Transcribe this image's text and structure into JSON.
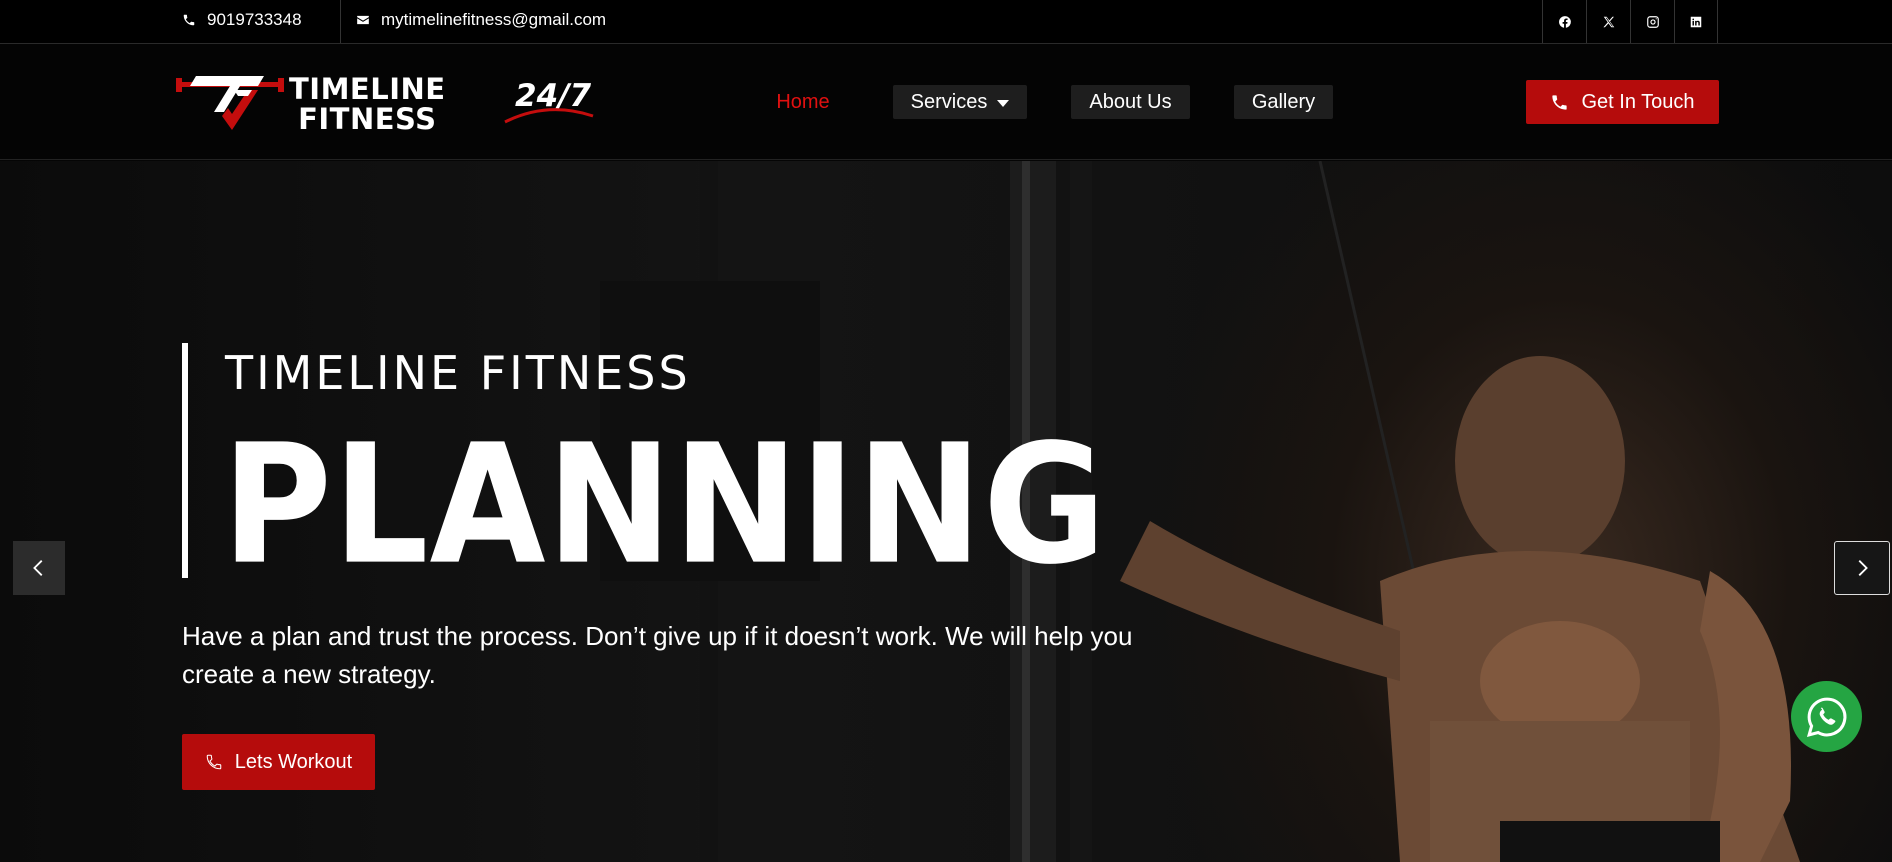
{
  "topbar": {
    "phone": "9019733348",
    "email": "mytimelinefitness@gmail.com",
    "socials": [
      "facebook-icon",
      "x-icon",
      "instagram-icon",
      "linkedin-icon"
    ]
  },
  "header": {
    "logo_line1": "TIMELINE",
    "logo_line2": "FITNESS",
    "badge": "24/7",
    "nav": {
      "home": "Home",
      "services": "Services",
      "about": "About Us",
      "gallery": "Gallery"
    },
    "cta_label": "Get In Touch"
  },
  "hero": {
    "kicker": "TIMELINE FITNESS",
    "title": "PLANNING",
    "text": "Have a plan and trust the process. Don’t give up if it doesn’t work. We will help you create a new strategy.",
    "button_label": "Lets Workout"
  },
  "colors": {
    "accent": "#b50c0c",
    "active_nav": "#e01010",
    "whatsapp": "#25a543"
  }
}
